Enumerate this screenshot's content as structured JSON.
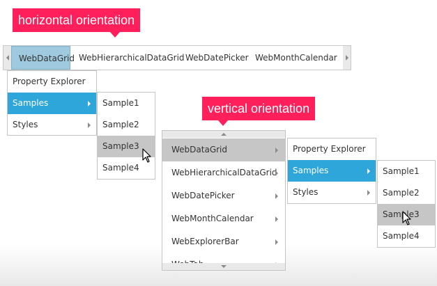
{
  "callouts": {
    "horizontal": "horizontal orientation",
    "vertical": "vertical orientation"
  },
  "horizontal_menu": {
    "items": [
      "WebDataGrid",
      "WebHierarchicalDataGrid",
      "WebDatePicker",
      "WebMonthCalendar"
    ],
    "selected": "WebDataGrid",
    "submenu": {
      "items": [
        "Property Explorer",
        "Samples",
        "Styles"
      ],
      "selected": "Samples"
    },
    "samples_menu": {
      "items": [
        "Sample1",
        "Sample2",
        "Sample3",
        "Sample4"
      ],
      "hovered": "Sample3"
    }
  },
  "vertical_menu": {
    "items": [
      "WebDataGrid",
      "WebHierarchicalDataGrid",
      "WebDatePicker",
      "WebMonthCalendar",
      "WebExplorerBar",
      "WebTab"
    ],
    "selected": "WebDataGrid",
    "submenu": {
      "items": [
        "Property Explorer",
        "Samples",
        "Styles"
      ],
      "selected": "Samples"
    },
    "samples_menu": {
      "items": [
        "Sample1",
        "Sample2",
        "Sample3",
        "Sample4"
      ],
      "hovered": "Sample3"
    }
  },
  "icons": {
    "scroll_left": "chevron-left-icon",
    "scroll_right": "chevron-right-icon",
    "scroll_up": "chevron-up-icon",
    "scroll_down": "chevron-down-icon",
    "submenu_arrow": "chevron-right-icon",
    "cursor": "mouse-pointer-icon"
  },
  "colors": {
    "callout": "#ff1f5a",
    "selected_blue": "#2fa6d9",
    "active_tab": "#9fc9de",
    "hover_gray": "#c6c6c6"
  }
}
